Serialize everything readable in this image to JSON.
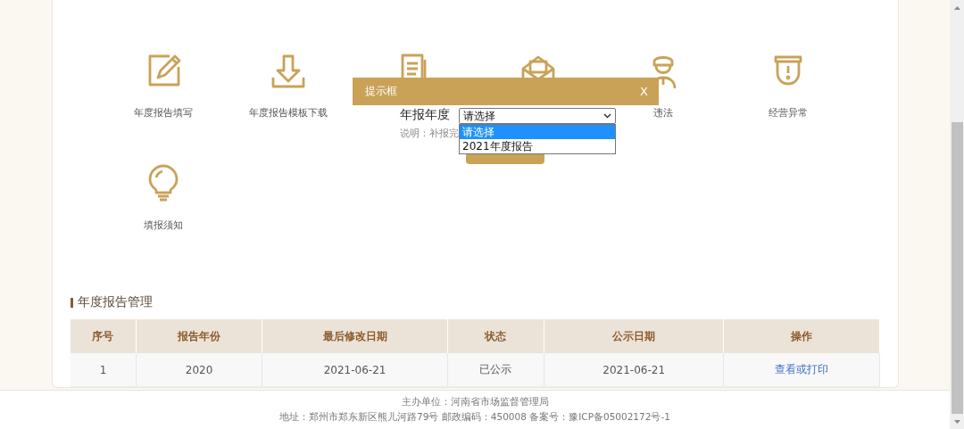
{
  "features": [
    {
      "kind": "edit",
      "label": "年度报告填写"
    },
    {
      "kind": "download",
      "label": "年度报告模板下载"
    },
    {
      "kind": "document"
    },
    {
      "kind": "envelope"
    },
    {
      "kind": "officer",
      "label": "违法"
    },
    {
      "kind": "shield",
      "label": "经营异常"
    },
    {
      "kind": "bulb",
      "label": "填报须知"
    }
  ],
  "modal": {
    "title": "提示框",
    "close": "X",
    "field_label": "年报年度",
    "select_value": "请选择",
    "note": "说明：补报完",
    "options": [
      {
        "label": "请选择",
        "selected": true
      },
      {
        "label": "2021年度报告",
        "selected": false
      }
    ]
  },
  "section_title": "年度报告管理",
  "table": {
    "columns": [
      "序号",
      "报告年份",
      "最后修改日期",
      "状态",
      "公示日期",
      "操作"
    ],
    "rows": [
      {
        "cells": [
          "1",
          "2020",
          "2021-06-21",
          "已公示",
          "2021-06-21"
        ],
        "action": "查看或打印"
      }
    ]
  },
  "footer": [
    "主办单位：河南省市场监督管理局",
    "地址：郑州市郑东新区熊儿河路79号 邮政编码：450008 备案号：豫ICP备05002172号-1"
  ]
}
